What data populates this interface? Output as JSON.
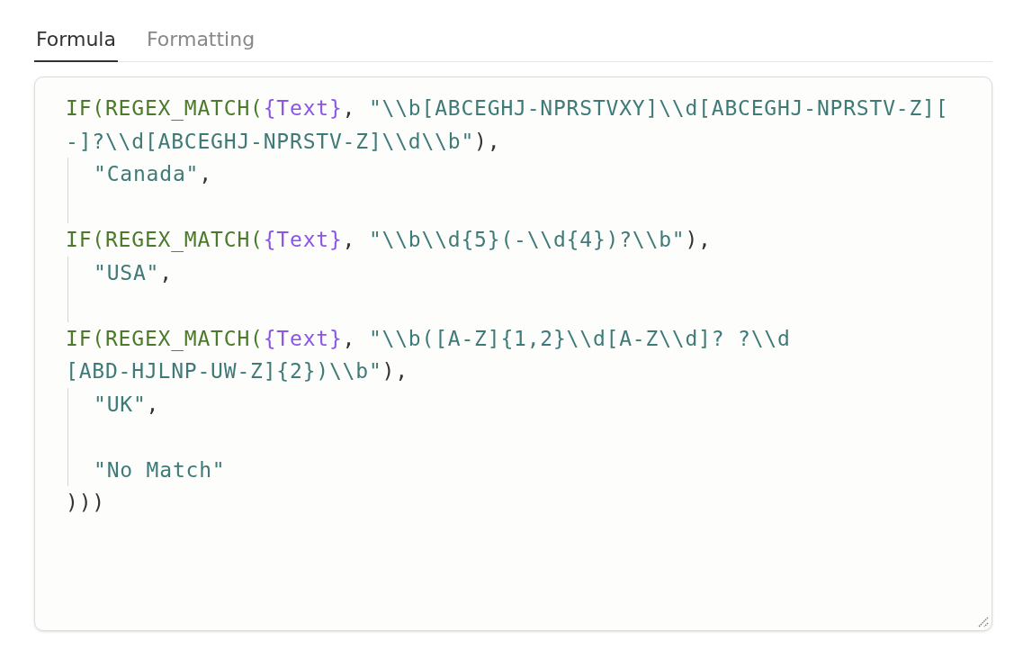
{
  "tabs": [
    {
      "label": "Formula",
      "selected": true
    },
    {
      "label": "Formatting",
      "selected": false
    }
  ],
  "editor": {
    "lines": [
      {
        "guide": false,
        "tokens": [
          {
            "kind": "fn",
            "text": "IF(REGEX_MATCH("
          },
          {
            "kind": "field",
            "text": "{Text}"
          },
          {
            "kind": "punct",
            "text": ", "
          },
          {
            "kind": "string",
            "text": "\"\\\\b[ABCEGHJ-NPRSTVXY]\\\\d[ABCEGHJ-NPRSTV-Z]["
          }
        ]
      },
      {
        "guide": false,
        "tokens": [
          {
            "kind": "string",
            "text": "-]?\\\\d[ABCEGHJ-NPRSTV-Z]\\\\d\\\\b\""
          },
          {
            "kind": "punct",
            "text": "),"
          }
        ]
      },
      {
        "guide": true,
        "tokens": [
          {
            "kind": "string",
            "text": "\"Canada\""
          },
          {
            "kind": "punct",
            "text": ","
          }
        ]
      },
      {
        "guide": true
      },
      {
        "guide": false,
        "tokens": [
          {
            "kind": "fn",
            "text": "IF(REGEX_MATCH("
          },
          {
            "kind": "field",
            "text": "{Text}"
          },
          {
            "kind": "punct",
            "text": ", "
          },
          {
            "kind": "string",
            "text": "\"\\\\b\\\\d{5}(-\\\\d{4})?\\\\b\""
          },
          {
            "kind": "punct",
            "text": "),"
          }
        ]
      },
      {
        "guide": true,
        "tokens": [
          {
            "kind": "string",
            "text": "\"USA\""
          },
          {
            "kind": "punct",
            "text": ","
          }
        ]
      },
      {
        "guide": true
      },
      {
        "guide": false,
        "tokens": [
          {
            "kind": "fn",
            "text": "IF(REGEX_MATCH("
          },
          {
            "kind": "field",
            "text": "{Text}"
          },
          {
            "kind": "punct",
            "text": ", "
          },
          {
            "kind": "string",
            "text": "\"\\\\b([A-Z]{1,2}\\\\d[A-Z\\\\d]? ?\\\\d"
          }
        ]
      },
      {
        "guide": false,
        "tokens": [
          {
            "kind": "string",
            "text": "[ABD-HJLNP-UW-Z]{2})\\\\b\""
          },
          {
            "kind": "punct",
            "text": "),"
          }
        ]
      },
      {
        "guide": true,
        "tokens": [
          {
            "kind": "string",
            "text": "\"UK\""
          },
          {
            "kind": "punct",
            "text": ","
          }
        ]
      },
      {
        "guide": true
      },
      {
        "guide": true,
        "tokens": [
          {
            "kind": "string",
            "text": "\"No Match\""
          }
        ]
      },
      {
        "guide": false,
        "tokens": [
          {
            "kind": "punct",
            "text": ")))"
          }
        ]
      }
    ]
  }
}
